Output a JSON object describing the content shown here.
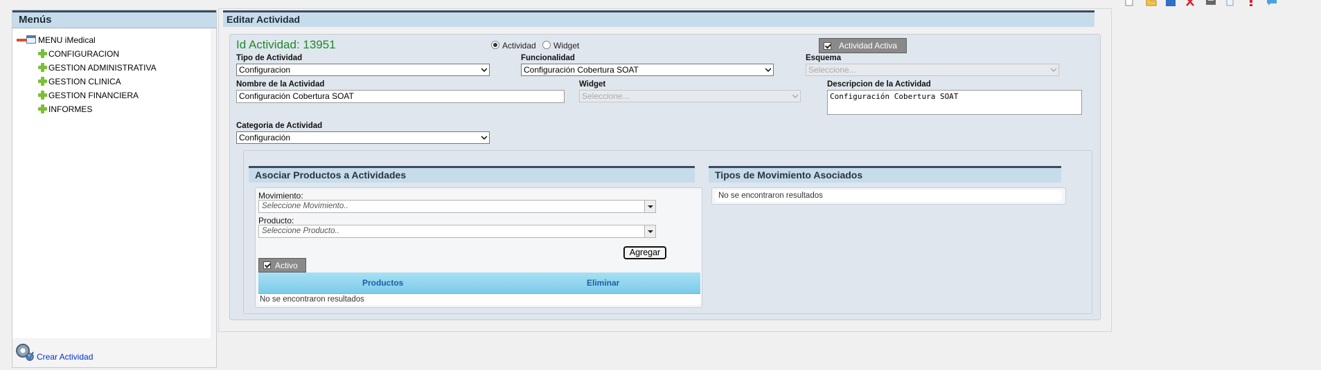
{
  "toolbar": {
    "icons": [
      "new-document-icon",
      "open-folder-icon",
      "save-icon",
      "delete-icon",
      "print-icon",
      "copy-icon",
      "alert-icon",
      "chat-icon"
    ]
  },
  "sidebar": {
    "title": "Menús",
    "root": "MENU iMedical",
    "items": [
      {
        "label": "CONFIGURACION"
      },
      {
        "label": "GESTION ADMINISTRATIVA"
      },
      {
        "label": "GESTION CLINICA"
      },
      {
        "label": "GESTION FINANCIERA"
      },
      {
        "label": "INFORMES"
      }
    ],
    "footer_link": "Crear Actividad"
  },
  "main": {
    "title": "Editar Actividad"
  },
  "form": {
    "id_label": "Id Actividad: 13951",
    "radio_actividad": "Actividad",
    "radio_widget": "Widget",
    "selected_radio": "Actividad",
    "actividad_activa": "Actividad Activa",
    "tipo_label": "Tipo de Actividad",
    "tipo_value": "Configuracion",
    "funcionalidad_label": "Funcionalidad",
    "funcionalidad_value": "Configuración Cobertura SOAT",
    "esquema_label": "Esquema",
    "esquema_placeholder": "Seleccione...",
    "nombre_label": "Nombre de la Actividad",
    "nombre_value": "Configuración Cobertura SOAT",
    "widget_label": "Widget",
    "widget_placeholder": "Seleccione...",
    "descripcion_label": "Descripcion de la Actividad",
    "descripcion_value": "Configuración Cobertura SOAT",
    "categoria_label": "Categoria de Actividad",
    "categoria_value": "Configuración"
  },
  "asociar": {
    "title": "Asociar Productos a Actividades",
    "movimiento_label": "Movimiento:",
    "movimiento_placeholder": "Seleccione Movimiento..",
    "producto_label": "Producto:",
    "producto_placeholder": "Seleccione Producto..",
    "agregar": "Agregar",
    "activo": "Activo",
    "columns": [
      "Productos",
      "Eliminar"
    ],
    "empty": "No se encontraron resultados"
  },
  "tipos_mov": {
    "title": "Tipos de Movimiento Asociados",
    "empty": "No se encontraron resultados"
  },
  "colors": {
    "header_bg": "#c6dcea",
    "id_green": "#1e8a2a",
    "grid_header": "#7ccbea",
    "link_blue": "#0033cc"
  }
}
